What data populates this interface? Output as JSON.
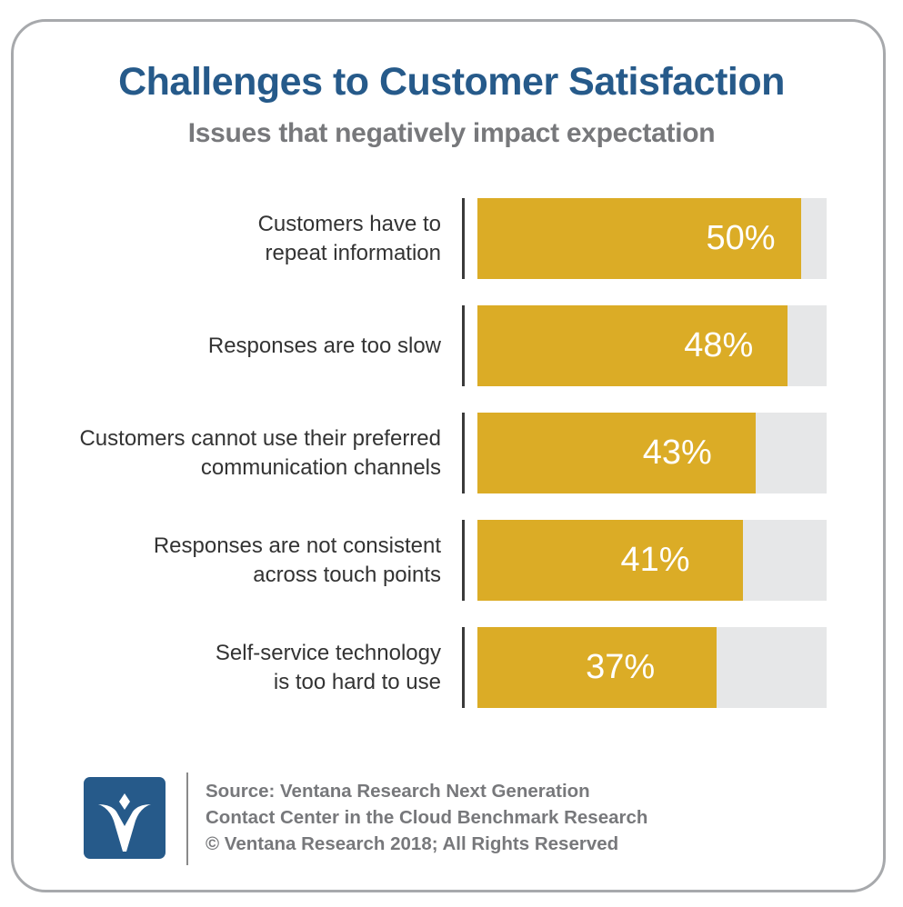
{
  "header": {
    "title": "Challenges to Customer Satisfaction",
    "subtitle": "Issues that negatively impact expectation"
  },
  "chart_data": {
    "type": "bar",
    "orientation": "horizontal",
    "title": "Challenges to Customer Satisfaction",
    "subtitle": "Issues that negatively impact expectation",
    "categories": [
      "Customers have to repeat information",
      "Responses are too slow",
      "Customers cannot use their preferred communication channels",
      "Responses are not consistent across touch points",
      "Self-service technology is too hard to use"
    ],
    "category_lines": [
      [
        "Customers have to",
        "repeat information"
      ],
      [
        "Responses are too slow"
      ],
      [
        "Customers cannot use their preferred",
        "communication channels"
      ],
      [
        "Responses are not consistent",
        "across touch points"
      ],
      [
        "Self-service technology",
        "is too hard to use"
      ]
    ],
    "values": [
      50,
      48,
      43,
      41,
      37
    ],
    "value_labels": [
      "50%",
      "48%",
      "43%",
      "41%",
      "37%"
    ],
    "unit": "%",
    "xlim": [
      0,
      54
    ],
    "xlabel": "",
    "ylabel": "",
    "grid": false,
    "legend": "none",
    "colors": {
      "bar": "#dbac26",
      "track": "#e6e7e8"
    }
  },
  "footer": {
    "logo_icon": "ventana-v-logo",
    "source_lines": [
      "Source: Ventana Research Next Generation",
      "Contact Center in the Cloud Benchmark Research",
      "© Ventana Research 2018; All Rights Reserved"
    ]
  },
  "colors": {
    "title": "#265a8a",
    "subtitle": "#77787b",
    "logo_bg": "#265a8a"
  }
}
